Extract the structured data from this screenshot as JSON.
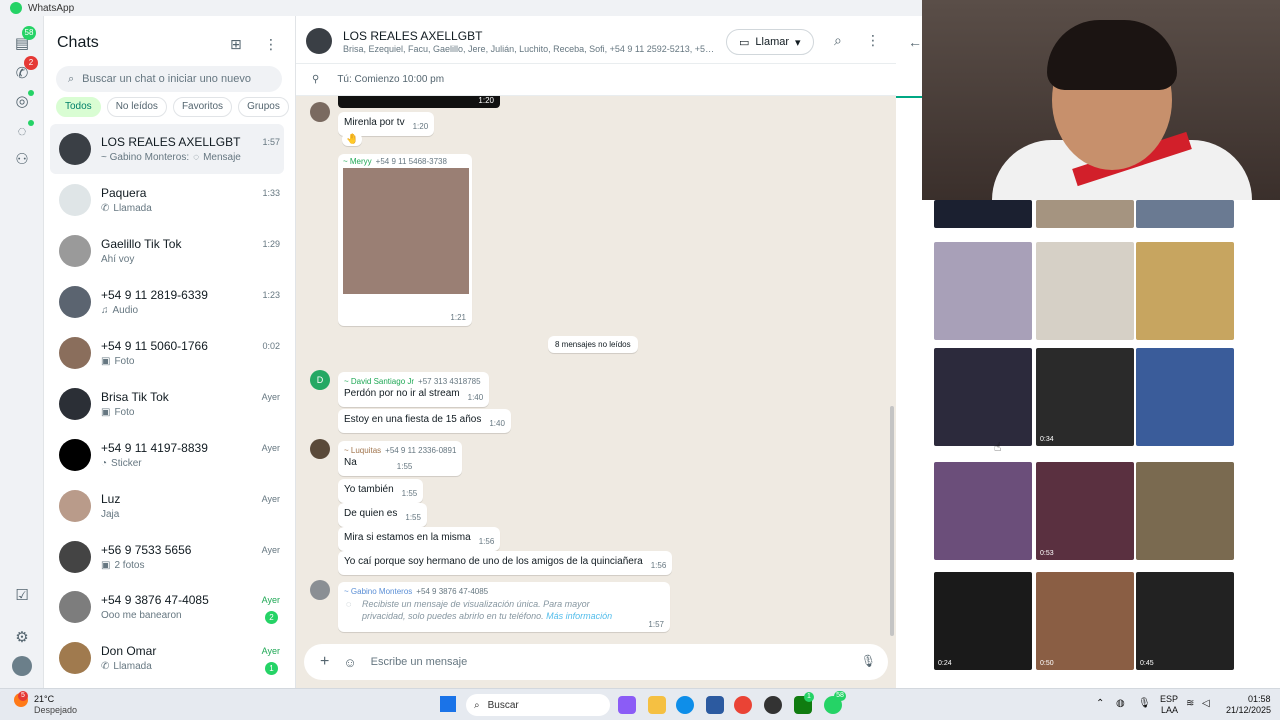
{
  "window": {
    "title": "WhatsApp"
  },
  "rail": {
    "chats_badge": "58",
    "calls_badge": "2"
  },
  "sidebar": {
    "title": "Chats",
    "search_placeholder": "Buscar un chat o iniciar uno nuevo",
    "filters": [
      "Todos",
      "No leídos",
      "Favoritos",
      "Grupos"
    ],
    "chats": [
      {
        "name": "LOS REALES AXELLGBT",
        "preview": "~ Gabino Monteros:",
        "preview_extra": "Mensaje",
        "time": "1:57"
      },
      {
        "name": "Paquera",
        "preview": "Llamada",
        "time": "1:33"
      },
      {
        "name": "Gaelillo Tik Tok",
        "preview": "Ahí voy",
        "time": "1:29"
      },
      {
        "name": "+54 9 11 2819-6339",
        "preview": "Audio",
        "time": "1:23"
      },
      {
        "name": "+54 9 11 5060-1766",
        "preview": "Foto",
        "time": "0:02"
      },
      {
        "name": "Brisa Tik Tok",
        "preview": "Foto",
        "time": "Ayer"
      },
      {
        "name": "+54 9 11 4197-8839",
        "preview": "Sticker",
        "time": "Ayer"
      },
      {
        "name": "Luz",
        "preview": "Jaja",
        "time": "Ayer"
      },
      {
        "name": "+56 9 7533 5656",
        "preview": "2 fotos",
        "time": "Ayer"
      },
      {
        "name": "+54 9 3876 47-4085",
        "preview": "Ooo me banearon",
        "time": "Ayer",
        "unread": "2"
      },
      {
        "name": "Don Omar",
        "preview": "Llamada",
        "time": "Ayer",
        "unread": "1"
      }
    ]
  },
  "conversation": {
    "title": "LOS REALES AXELLGBT",
    "members": "Brisa, Ezequiel, Facu, Gaelillo, Jere, Julián, Luchito, Receba, Sofi, +54 9 11 2592-5213, +57 313 ...",
    "call_label": "Llamar",
    "pinned": "Tú: Comienzo 10:00 pm",
    "video_time": "1:20",
    "messages": [
      {
        "text": "Mirenla por tv",
        "time": "1:20"
      },
      {
        "reaction": "🤚"
      },
      {
        "sender": "~ Meryy",
        "phone": "+54 9 11 5468-3738",
        "time": "1:21"
      },
      {
        "divider": "8 mensajes no leídos"
      },
      {
        "sender": "~ David Santiago Jr",
        "phone": "+57 313 4318785",
        "text": "Perdón por no ir al stream",
        "time": "1:40"
      },
      {
        "text": "Estoy en una fiesta de 15 años",
        "time": "1:40"
      },
      {
        "sender": "~ Luquitas",
        "phone": "+54 9 11 2336-0891",
        "text": "Na",
        "time": "1:55"
      },
      {
        "text": "Yo también",
        "time": "1:55"
      },
      {
        "text": "De quien es",
        "time": "1:55"
      },
      {
        "text": "Mira si estamos en la misma",
        "time": "1:56"
      },
      {
        "text": "Yo caí porque soy hermano de uno de los amigos de la quinciañera",
        "time": "1:56"
      },
      {
        "sender": "~ Gabino Monteros",
        "phone": "+54 9 3876 47-4085",
        "text": "Recibiste un mensaje de visualización única. Para mayor privacidad, solo puedes abrirlo en tu teléfono.",
        "link": "Más información",
        "time": "1:57"
      }
    ],
    "composer_placeholder": "Escribe un mensaje"
  },
  "media_panel": {
    "durations": [
      "0:34",
      "0:53",
      "0:24",
      "0:50",
      "0:45"
    ]
  },
  "taskbar": {
    "weather_badge": "5",
    "weather_temp": "21°C",
    "weather_desc": "Despejado",
    "search_label": "Buscar",
    "lang": "ESP",
    "lang_sub": "LAA",
    "time": "01:58",
    "date": "21/12/2025",
    "whatsapp_badge": "58",
    "xbox_badge": "1"
  },
  "colors": {
    "accent": "#25d366",
    "green_text": "#1fa855",
    "chip_active": "#d9fdd3",
    "chat_bg": "#efeae2"
  }
}
